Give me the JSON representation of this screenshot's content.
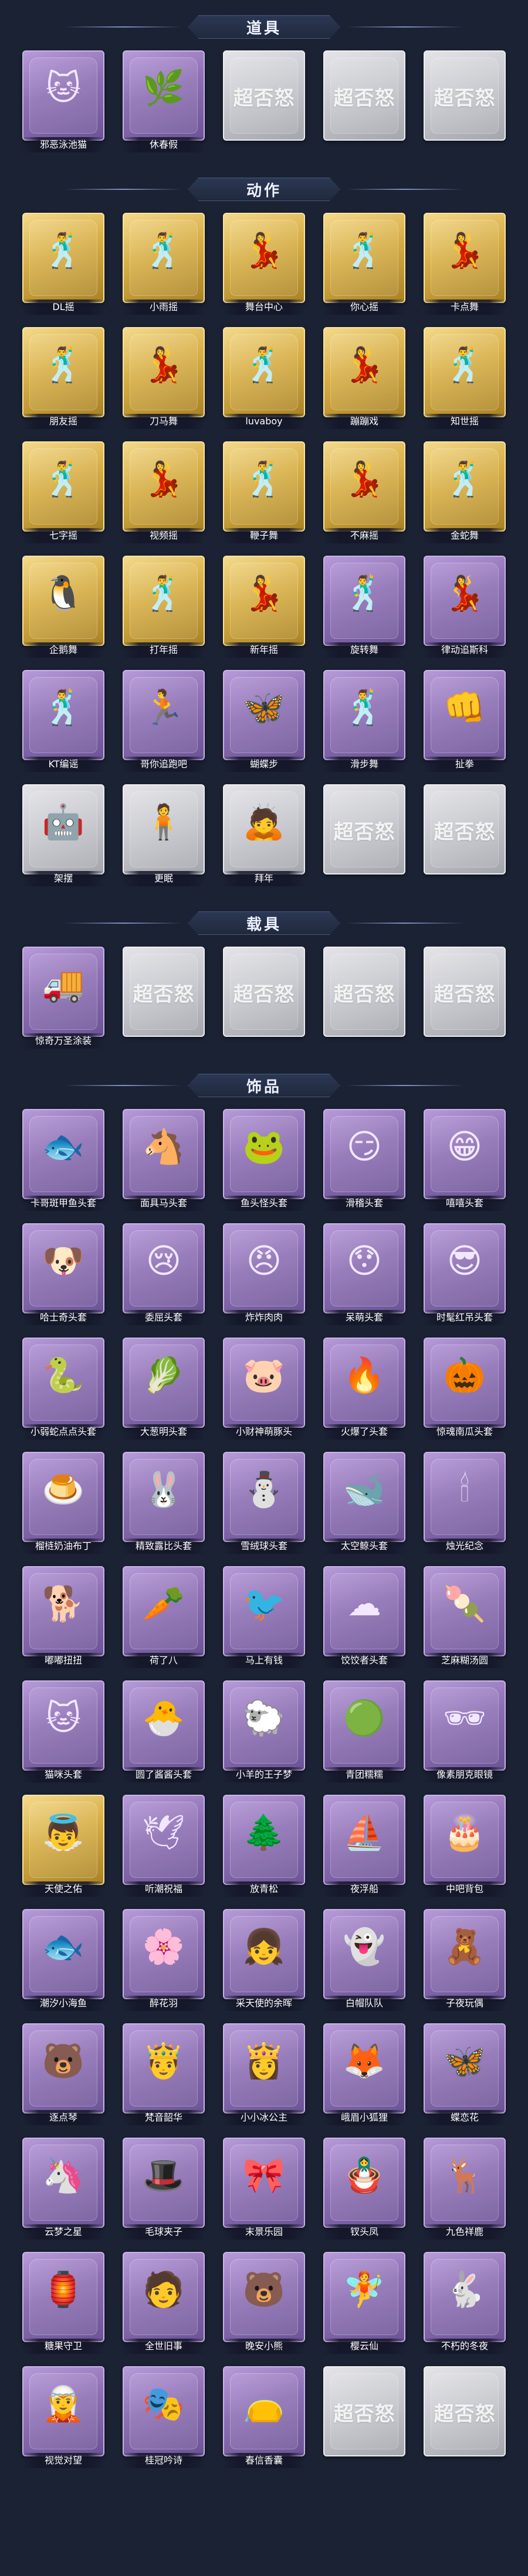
{
  "sections": [
    {
      "title": "道具",
      "items": [
        {
          "name": "邪恶泳池猫",
          "style": "purple",
          "icon": "cat-bag-icon",
          "glyph": "🐱"
        },
        {
          "name": "休春假",
          "style": "purple",
          "icon": "stick-icon",
          "glyph": "🌿"
        },
        {
          "name": "",
          "style": "grey",
          "icon": "placeholder-logo",
          "logo": "超否怒"
        },
        {
          "name": "",
          "style": "grey",
          "icon": "placeholder-logo",
          "logo": "超否怒"
        },
        {
          "name": "",
          "style": "grey",
          "icon": "placeholder-logo",
          "logo": "超否怒"
        }
      ]
    },
    {
      "title": "动作",
      "items": [
        {
          "name": "DL摇",
          "style": "gold",
          "icon": "dance-pose-icon",
          "glyph": "🕺"
        },
        {
          "name": "小雨摇",
          "style": "gold",
          "icon": "dance-pose-icon",
          "glyph": "🕺"
        },
        {
          "name": "舞台中心",
          "style": "gold",
          "icon": "dance-pose-icon",
          "glyph": "💃"
        },
        {
          "name": "你心摇",
          "style": "gold",
          "icon": "dance-pose-icon",
          "glyph": "🕺"
        },
        {
          "name": "卡点舞",
          "style": "gold",
          "icon": "dance-pose-icon",
          "glyph": "💃"
        },
        {
          "name": "朋友摇",
          "style": "gold",
          "icon": "dance-pose-icon",
          "glyph": "🕺"
        },
        {
          "name": "刀马舞",
          "style": "gold",
          "icon": "dance-pose-icon",
          "glyph": "💃"
        },
        {
          "name": "luvaboy",
          "style": "gold",
          "icon": "dance-pose-icon",
          "glyph": "🕺"
        },
        {
          "name": "蹦蹦戏",
          "style": "gold",
          "icon": "dance-pose-icon",
          "glyph": "💃"
        },
        {
          "name": "知世摇",
          "style": "gold",
          "icon": "dance-pose-icon",
          "glyph": "🕺"
        },
        {
          "name": "七字摇",
          "style": "gold",
          "icon": "dance-pose-icon",
          "glyph": "🕺"
        },
        {
          "name": "视频摇",
          "style": "gold",
          "icon": "dance-pose-icon",
          "glyph": "💃"
        },
        {
          "name": "鞭子舞",
          "style": "gold",
          "icon": "dance-pose-icon",
          "glyph": "🕺"
        },
        {
          "name": "不麻摇",
          "style": "gold",
          "icon": "dance-pose-icon",
          "glyph": "💃"
        },
        {
          "name": "金蛇舞",
          "style": "gold",
          "icon": "dance-pose-icon",
          "glyph": "🕺"
        },
        {
          "name": "企鹅舞",
          "style": "gold",
          "icon": "dance-pose-icon",
          "glyph": "🐧"
        },
        {
          "name": "打年摇",
          "style": "gold",
          "icon": "dance-pose-icon",
          "glyph": "🕺"
        },
        {
          "name": "新年摇",
          "style": "gold",
          "icon": "dance-pose-icon",
          "glyph": "💃"
        },
        {
          "name": "旋转舞",
          "style": "purple",
          "icon": "dance-pose-icon",
          "glyph": "🕺"
        },
        {
          "name": "律动追斯科",
          "style": "purple",
          "icon": "dance-pose-icon",
          "glyph": "💃"
        },
        {
          "name": "KT编谣",
          "style": "purple",
          "icon": "dance-pose-icon",
          "glyph": "🕺"
        },
        {
          "name": "哥你追跑吧",
          "style": "purple",
          "icon": "dance-pose-icon",
          "glyph": "🏃"
        },
        {
          "name": "蝴蝶步",
          "style": "purple",
          "icon": "dance-pose-icon",
          "glyph": "🦋"
        },
        {
          "name": "滑步舞",
          "style": "purple",
          "icon": "dance-pose-icon",
          "glyph": "🕺"
        },
        {
          "name": "扯拳",
          "style": "purple",
          "icon": "dance-pose-icon",
          "glyph": "👊"
        },
        {
          "name": "架摆",
          "style": "grey",
          "icon": "character-icon",
          "glyph": "🤖"
        },
        {
          "name": "更眠",
          "style": "grey",
          "icon": "character-icon",
          "glyph": "🧍"
        },
        {
          "name": "拜年",
          "style": "grey",
          "icon": "character-icon",
          "glyph": "🙇"
        },
        {
          "name": "",
          "style": "grey",
          "icon": "placeholder-logo",
          "logo": "超否怒"
        },
        {
          "name": "",
          "style": "grey",
          "icon": "placeholder-logo",
          "logo": "超否怒"
        }
      ]
    },
    {
      "title": "载具",
      "items": [
        {
          "name": "惊奇万圣涂装",
          "style": "purple",
          "icon": "vehicle-icon",
          "glyph": "🚚"
        },
        {
          "name": "",
          "style": "grey",
          "icon": "placeholder-logo",
          "logo": "超否怒"
        },
        {
          "name": "",
          "style": "grey",
          "icon": "placeholder-logo",
          "logo": "超否怒"
        },
        {
          "name": "",
          "style": "grey",
          "icon": "placeholder-logo",
          "logo": "超否怒"
        },
        {
          "name": "",
          "style": "grey",
          "icon": "placeholder-logo",
          "logo": "超否怒"
        }
      ]
    },
    {
      "title": "饰品",
      "items": [
        {
          "name": "卡哥斑甲鱼头套",
          "style": "purple",
          "icon": "fish-head-icon",
          "glyph": "🐟"
        },
        {
          "name": "面具马头套",
          "style": "purple",
          "icon": "horse-head-icon",
          "glyph": "🐴"
        },
        {
          "name": "鱼头怪头套",
          "style": "purple",
          "icon": "fish-monster-icon",
          "glyph": "🐸"
        },
        {
          "name": "滑稽头套",
          "style": "purple",
          "icon": "smile-face-icon",
          "glyph": "😏"
        },
        {
          "name": "嘻嘻头套",
          "style": "purple",
          "icon": "grin-face-icon",
          "glyph": "😁"
        },
        {
          "name": "哈士奇头套",
          "style": "purple",
          "icon": "dog-head-icon",
          "glyph": "🐶"
        },
        {
          "name": "委屈头套",
          "style": "purple",
          "icon": "sad-face-icon",
          "glyph": "😢"
        },
        {
          "name": "炸炸肉肉",
          "style": "purple",
          "icon": "angry-block-icon",
          "glyph": "😠"
        },
        {
          "name": "呆萌头套",
          "style": "purple",
          "icon": "stunned-face-icon",
          "glyph": "😯"
        },
        {
          "name": "时髦红吊头套",
          "style": "purple",
          "icon": "pikachu-icon",
          "glyph": "😎"
        },
        {
          "name": "小弱蛇点点头套",
          "style": "purple",
          "icon": "blob-head-icon",
          "glyph": "🐍"
        },
        {
          "name": "大葱明头套",
          "style": "purple",
          "icon": "leek-head-icon",
          "glyph": "🥬"
        },
        {
          "name": "小财神萌豚头",
          "style": "purple",
          "icon": "piggy-head-icon",
          "glyph": "🐷"
        },
        {
          "name": "火爆了头套",
          "style": "purple",
          "icon": "fire-head-icon",
          "glyph": "🔥"
        },
        {
          "name": "惊魂南瓜头套",
          "style": "purple",
          "icon": "pumpkin-icon",
          "glyph": "🎃"
        },
        {
          "name": "榴梿奶油布丁",
          "style": "purple",
          "icon": "pudding-icon",
          "glyph": "🍮"
        },
        {
          "name": "精致露比头套",
          "style": "purple",
          "icon": "pink-bunny-icon",
          "glyph": "🐰"
        },
        {
          "name": "雪绒球头套",
          "style": "purple",
          "icon": "snow-animal-icon",
          "glyph": "⛄"
        },
        {
          "name": "太空鲸头套",
          "style": "purple",
          "icon": "whale-head-icon",
          "glyph": "🐋"
        },
        {
          "name": "烛光纪念",
          "style": "purple",
          "icon": "candle-icon",
          "glyph": "🕯"
        },
        {
          "name": "嘟嘟扭扭",
          "style": "purple",
          "icon": "dog-ear-icon",
          "glyph": "🐕"
        },
        {
          "name": "荷了八",
          "style": "purple",
          "icon": "radish-icon",
          "glyph": "🥕"
        },
        {
          "name": "马上有钱",
          "style": "purple",
          "icon": "bird-head-icon",
          "glyph": "🐦"
        },
        {
          "name": "饺饺者头套",
          "style": "purple",
          "icon": "cloud-face-icon",
          "glyph": "☁"
        },
        {
          "name": "芝麻糊汤圆",
          "style": "purple",
          "icon": "dumpling-icon",
          "glyph": "🍡"
        },
        {
          "name": "猫咪头套",
          "style": "purple",
          "icon": "cat-head-icon",
          "glyph": "🐱"
        },
        {
          "name": "圆了酱酱头套",
          "style": "purple",
          "icon": "blue-mascot-icon",
          "glyph": "🐣"
        },
        {
          "name": "小羊的王子梦",
          "style": "purple",
          "icon": "sheep-head-icon",
          "glyph": "🐑"
        },
        {
          "name": "青团糯糯",
          "style": "purple",
          "icon": "green-bun-icon",
          "glyph": "🟢"
        },
        {
          "name": "像素朋克眼镜",
          "style": "purple",
          "icon": "pixel-glasses-icon",
          "glyph": "🕶"
        },
        {
          "name": "天使之佑",
          "style": "gold",
          "icon": "angel-wings-icon",
          "glyph": "👼"
        },
        {
          "name": "听潮祝福",
          "style": "purple",
          "icon": "wings-icon",
          "glyph": "🕊"
        },
        {
          "name": "放青松",
          "style": "purple",
          "icon": "bonsai-icon",
          "glyph": "🌲"
        },
        {
          "name": "夜浮船",
          "style": "purple",
          "icon": "floating-ship-icon",
          "glyph": "⛵"
        },
        {
          "name": "中吧背包",
          "style": "purple",
          "icon": "cake-backpack-icon",
          "glyph": "🎂"
        },
        {
          "name": "潮汐小海鱼",
          "style": "purple",
          "icon": "blue-cat-icon",
          "glyph": "🐟"
        },
        {
          "name": "醉花羽",
          "style": "purple",
          "icon": "flower-wing-icon",
          "glyph": "🌸"
        },
        {
          "name": "采天使的余晖",
          "style": "purple",
          "icon": "girl-doll-icon",
          "glyph": "👧"
        },
        {
          "name": "白帽队队",
          "style": "purple",
          "icon": "ghost-icon",
          "glyph": "👻"
        },
        {
          "name": "子夜玩偶",
          "style": "purple",
          "icon": "doll-icon",
          "glyph": "🧸"
        },
        {
          "name": "逐点琴",
          "style": "purple",
          "icon": "pink-bear-icon",
          "glyph": "🐻"
        },
        {
          "name": "梵音韶华",
          "style": "purple",
          "icon": "prince-doll-icon",
          "glyph": "🤴"
        },
        {
          "name": "小小冰公主",
          "style": "purple",
          "icon": "ice-princess-icon",
          "glyph": "👸"
        },
        {
          "name": "峨眉小狐狸",
          "style": "purple",
          "icon": "fox-icon",
          "glyph": "🦊"
        },
        {
          "name": "蝶恋花",
          "style": "purple",
          "icon": "butterfly-icon",
          "glyph": "🦋"
        },
        {
          "name": "云梦之星",
          "style": "purple",
          "icon": "unicorn-icon",
          "glyph": "🦄"
        },
        {
          "name": "毛球夹子",
          "style": "purple",
          "icon": "hat-doll-icon",
          "glyph": "🎩"
        },
        {
          "name": "末景乐园",
          "style": "purple",
          "icon": "pink-doll-icon",
          "glyph": "🎀"
        },
        {
          "name": "钗头凤",
          "style": "purple",
          "icon": "phoenix-doll-icon",
          "glyph": "🪆"
        },
        {
          "name": "九色祥鹿",
          "style": "purple",
          "icon": "deer-icon",
          "glyph": "🦌"
        },
        {
          "name": "糖果守卫",
          "style": "purple",
          "icon": "lantern-icon",
          "glyph": "🏮"
        },
        {
          "name": "全世旧事",
          "style": "purple",
          "icon": "keychain-icon",
          "glyph": "🧑"
        },
        {
          "name": "晚安小熊",
          "style": "purple",
          "icon": "bear-charm-icon",
          "glyph": "🐻"
        },
        {
          "name": "樱云仙",
          "style": "purple",
          "icon": "fairy-charm-icon",
          "glyph": "🧚"
        },
        {
          "name": "不朽的冬夜",
          "style": "purple",
          "icon": "rabbit-charm-icon",
          "glyph": "🐇"
        },
        {
          "name": "视觉对望",
          "style": "purple",
          "icon": "doll-charm-icon",
          "glyph": "🧝"
        },
        {
          "name": "桂冠吟诗",
          "style": "purple",
          "icon": "poet-charm-icon",
          "glyph": "🎭"
        },
        {
          "name": "春信香囊",
          "style": "purple",
          "icon": "sachet-icon",
          "glyph": "👝"
        },
        {
          "name": "",
          "style": "grey",
          "icon": "placeholder-logo",
          "logo": "超否怒"
        },
        {
          "name": "",
          "style": "grey",
          "icon": "placeholder-logo",
          "logo": "超否怒"
        }
      ]
    }
  ]
}
